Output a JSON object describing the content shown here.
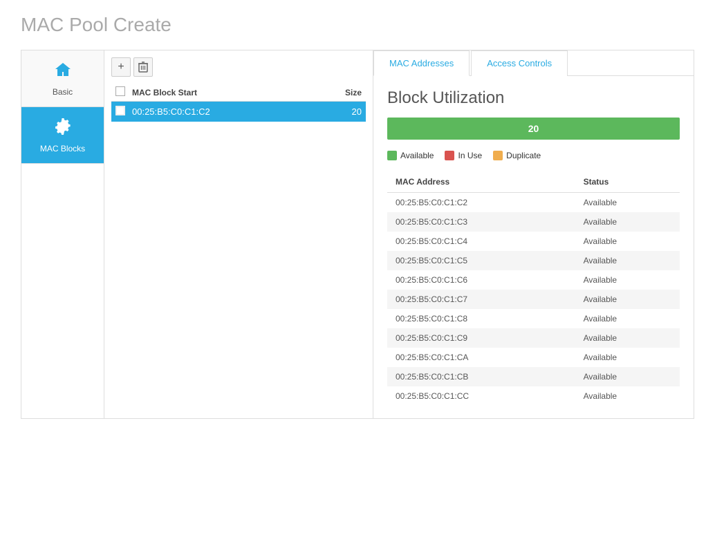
{
  "page": {
    "title": "MAC Pool",
    "subtitle": "Create"
  },
  "sidebar": {
    "items": [
      {
        "id": "basic",
        "label": "Basic",
        "icon": "🏠",
        "active": false
      },
      {
        "id": "mac-blocks",
        "label": "MAC Blocks",
        "icon": "⚙",
        "active": true
      }
    ]
  },
  "toolbar": {
    "add_label": "+",
    "delete_label": "🗑"
  },
  "blocks_table": {
    "col_check": "",
    "col_mac": "MAC Block Start",
    "col_size": "Size",
    "rows": [
      {
        "mac": "00:25:B5:C0:C1:C2",
        "size": "20",
        "selected": true
      }
    ]
  },
  "tabs": [
    {
      "id": "mac-addresses",
      "label": "MAC Addresses",
      "active": true
    },
    {
      "id": "access-controls",
      "label": "Access Controls",
      "active": false
    }
  ],
  "block_utilization": {
    "title": "Block Utilization",
    "value": 20,
    "max": 20,
    "bar_label": "20",
    "bar_color": "#5cb85c",
    "legend": [
      {
        "label": "Available",
        "color": "#5cb85c"
      },
      {
        "label": "In Use",
        "color": "#d9534f"
      },
      {
        "label": "Duplicate",
        "color": "#f0ad4e"
      }
    ]
  },
  "mac_addresses_table": {
    "col_mac": "MAC Address",
    "col_status": "Status",
    "rows": [
      {
        "mac": "00:25:B5:C0:C1:C2",
        "status": "Available"
      },
      {
        "mac": "00:25:B5:C0:C1:C3",
        "status": "Available"
      },
      {
        "mac": "00:25:B5:C0:C1:C4",
        "status": "Available"
      },
      {
        "mac": "00:25:B5:C0:C1:C5",
        "status": "Available"
      },
      {
        "mac": "00:25:B5:C0:C1:C6",
        "status": "Available"
      },
      {
        "mac": "00:25:B5:C0:C1:C7",
        "status": "Available"
      },
      {
        "mac": "00:25:B5:C0:C1:C8",
        "status": "Available"
      },
      {
        "mac": "00:25:B5:C0:C1:C9",
        "status": "Available"
      },
      {
        "mac": "00:25:B5:C0:C1:CA",
        "status": "Available"
      },
      {
        "mac": "00:25:B5:C0:C1:CB",
        "status": "Available"
      },
      {
        "mac": "00:25:B5:C0:C1:CC",
        "status": "Available"
      }
    ]
  }
}
